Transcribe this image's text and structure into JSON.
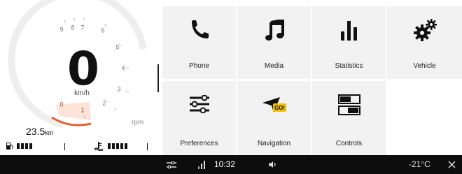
{
  "cluster": {
    "speed": "0",
    "speed_unit": "km/h",
    "rpm_label": "rpm",
    "odometer_value": "23.5",
    "odometer_unit": "km",
    "gauge_numbers": [
      "0",
      "1",
      "2",
      "3",
      "4",
      "5",
      "6",
      "7",
      "8",
      "9"
    ],
    "fuel_level_bars": 4,
    "coolant_level_bars": 5,
    "accent_color": "#e0612f",
    "redline_color": "#c0392b"
  },
  "tiles": [
    {
      "label": "Phone",
      "icon": "phone-icon"
    },
    {
      "label": "Media",
      "icon": "music-note-icon"
    },
    {
      "label": "Statistics",
      "icon": "bar-chart-icon"
    },
    {
      "label": "Vehicle",
      "icon": "gears-icon"
    },
    {
      "label": "Preferences",
      "icon": "sliders-icon"
    },
    {
      "label": "Navigation",
      "icon": "navigation-arrow-icon"
    },
    {
      "label": "Controls",
      "icon": "controls-icon"
    }
  ],
  "navigation_badge": "GO!",
  "status_bar": {
    "clock": "10:32",
    "temperature": "-21°C"
  }
}
